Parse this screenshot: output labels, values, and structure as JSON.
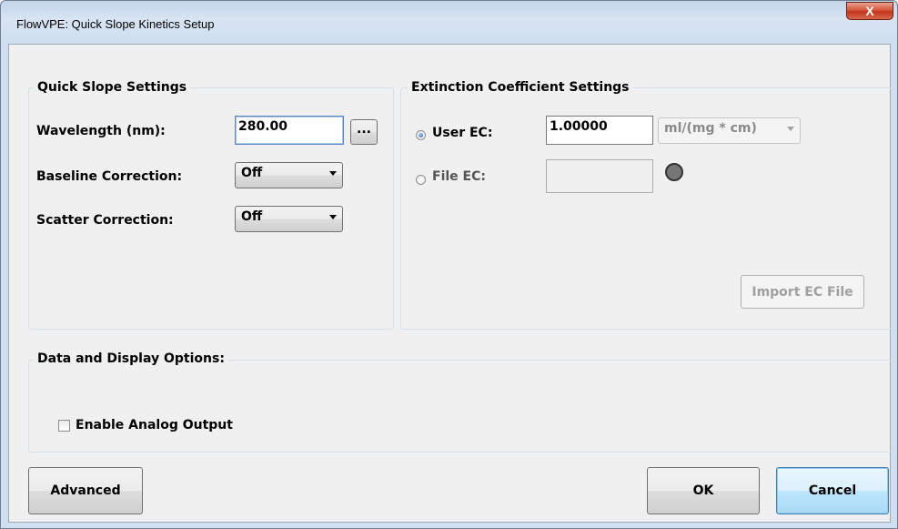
{
  "window": {
    "title": "FlowVPE: Quick Slope Kinetics Setup",
    "close_glyph": "X"
  },
  "quick_slope": {
    "group_title": "Quick Slope Settings",
    "wavelength_label": "Wavelength (nm):",
    "wavelength_value": "280.00",
    "browse_label": "...",
    "baseline_label": "Baseline Correction:",
    "baseline_value": "Off",
    "scatter_label": "Scatter Correction:",
    "scatter_value": "Off"
  },
  "extinction": {
    "group_title": "Extinction Coefficient Settings",
    "user_ec_label": "User EC:",
    "user_ec_value": "1.00000",
    "user_ec_selected": true,
    "unit_value": "ml/(mg * cm)",
    "file_ec_label": "File EC:",
    "file_ec_value": "",
    "import_button": "Import EC File"
  },
  "display_options": {
    "group_title": "Data and Display Options:",
    "analog_output_label": "Enable Analog Output",
    "analog_output_checked": false
  },
  "buttons": {
    "advanced": "Advanced",
    "ok": "OK",
    "cancel": "Cancel"
  }
}
